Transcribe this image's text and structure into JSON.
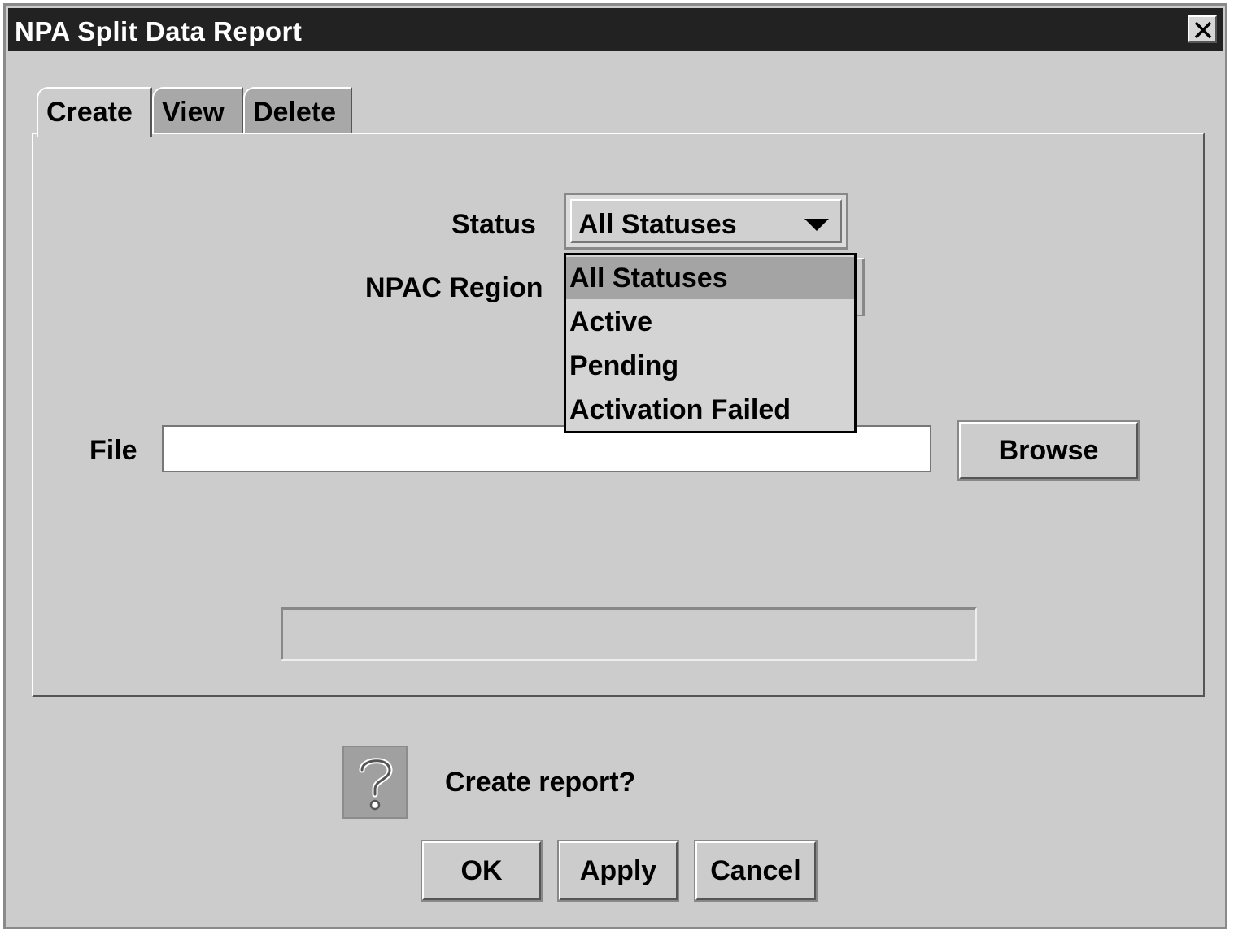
{
  "window": {
    "title": "NPA Split Data Report",
    "close_icon": "close-icon"
  },
  "tabs": [
    {
      "label": "Create",
      "active": true
    },
    {
      "label": "View",
      "active": false
    },
    {
      "label": "Delete",
      "active": false
    }
  ],
  "form": {
    "status_label": "Status",
    "status_value": "All Statuses",
    "region_label": "NPAC Region",
    "file_label": "File",
    "file_value": "",
    "browse_label": "Browse"
  },
  "status_dropdown": {
    "options": [
      "All Statuses",
      "Active",
      "Pending",
      "Activation Failed"
    ],
    "highlighted": "All Statuses"
  },
  "dialog": {
    "icon": "question-icon",
    "message": "Create report?",
    "ok_label": "OK",
    "apply_label": "Apply",
    "cancel_label": "Cancel"
  },
  "colors": {
    "background": "#cccccc",
    "titlebar": "#222222",
    "highlight": "#a4a4a4"
  }
}
